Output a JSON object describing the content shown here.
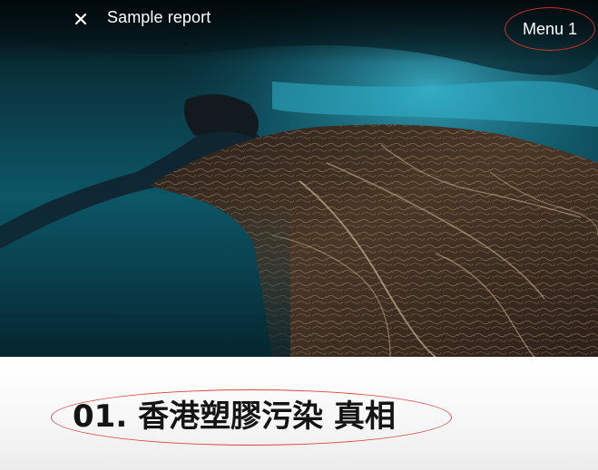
{
  "header": {
    "close_icon": "close-icon",
    "title": "Sample report",
    "menu_label": "Menu 1"
  },
  "hero": {
    "image_icon": "manta-ray-underwater-photo"
  },
  "section": {
    "heading": "01. 香港塑膠污染 真相"
  },
  "colors": {
    "annotation_red": "#c8312a",
    "heading_text": "#141414",
    "water_teal": "#0c5666",
    "ray_brown": "#3a2c22"
  }
}
